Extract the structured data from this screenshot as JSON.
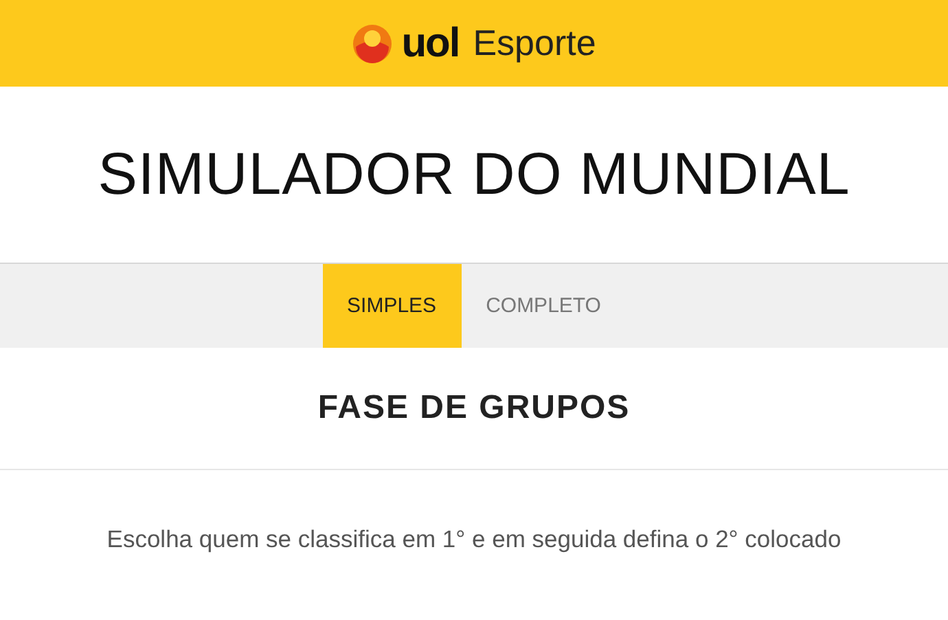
{
  "header": {
    "logo": "uol",
    "section": "Esporte"
  },
  "title": "SIMULADOR DO MUNDIAL",
  "tabs": [
    {
      "label": "SIMPLES",
      "selected": true
    },
    {
      "label": "COMPLETO",
      "selected": false
    }
  ],
  "phase": "FASE DE GRUPOS",
  "instruction": "Escolha quem se classifica em 1° e em seguida defina o 2° colocado"
}
